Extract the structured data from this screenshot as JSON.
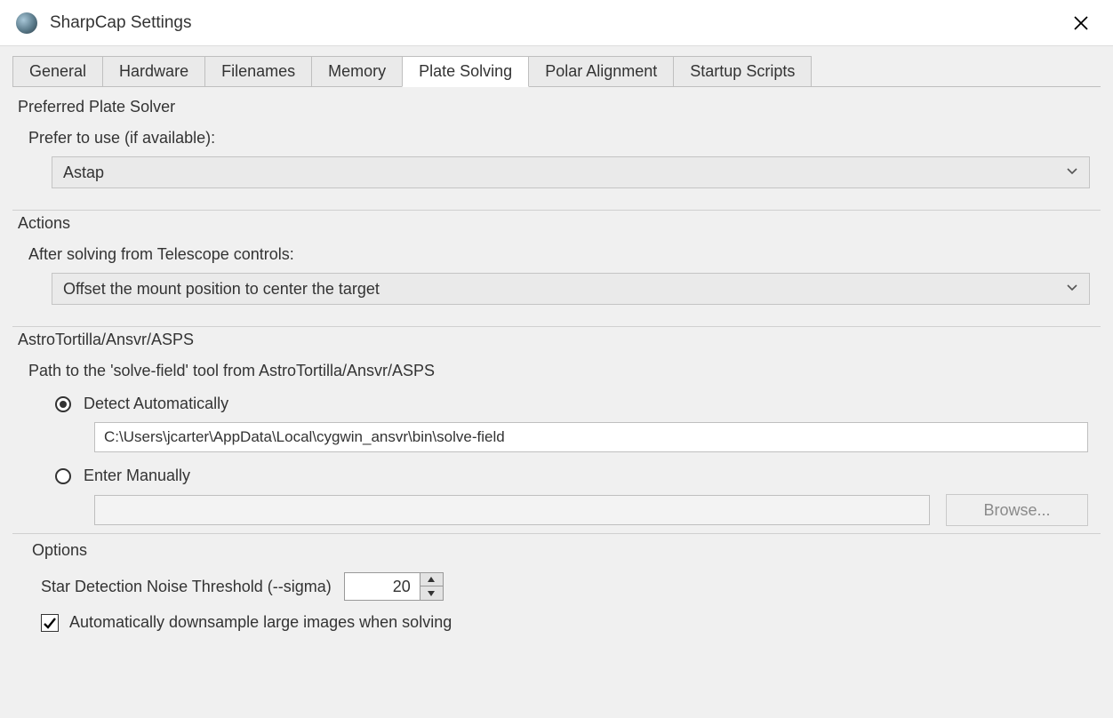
{
  "window": {
    "title": "SharpCap Settings"
  },
  "tabs": [
    {
      "label": "General"
    },
    {
      "label": "Hardware"
    },
    {
      "label": "Filenames"
    },
    {
      "label": "Memory"
    },
    {
      "label": "Plate Solving",
      "active": true
    },
    {
      "label": "Polar Alignment"
    },
    {
      "label": "Startup Scripts"
    }
  ],
  "preferred": {
    "group_label": "Preferred Plate Solver",
    "field_label": "Prefer to use (if available):",
    "selected": "Astap"
  },
  "actions": {
    "group_label": "Actions",
    "field_label": "After solving from Telescope controls:",
    "selected": "Offset the mount position to center the target"
  },
  "astro": {
    "group_label": "AstroTortilla/Ansvr/ASPS",
    "field_label": "Path to the 'solve-field' tool from AstroTortilla/Ansvr/ASPS",
    "radio_detect": "Detect Automatically",
    "detect_path": "C:\\Users\\jcarter\\AppData\\Local\\cygwin_ansvr\\bin\\solve-field",
    "radio_manual": "Enter Manually",
    "manual_path": "",
    "browse_label": "Browse..."
  },
  "options": {
    "group_label": "Options",
    "sigma_label": "Star Detection Noise Threshold (--sigma)",
    "sigma_value": "20",
    "downsample_label": "Automatically downsample large images when solving",
    "downsample_checked": true
  }
}
